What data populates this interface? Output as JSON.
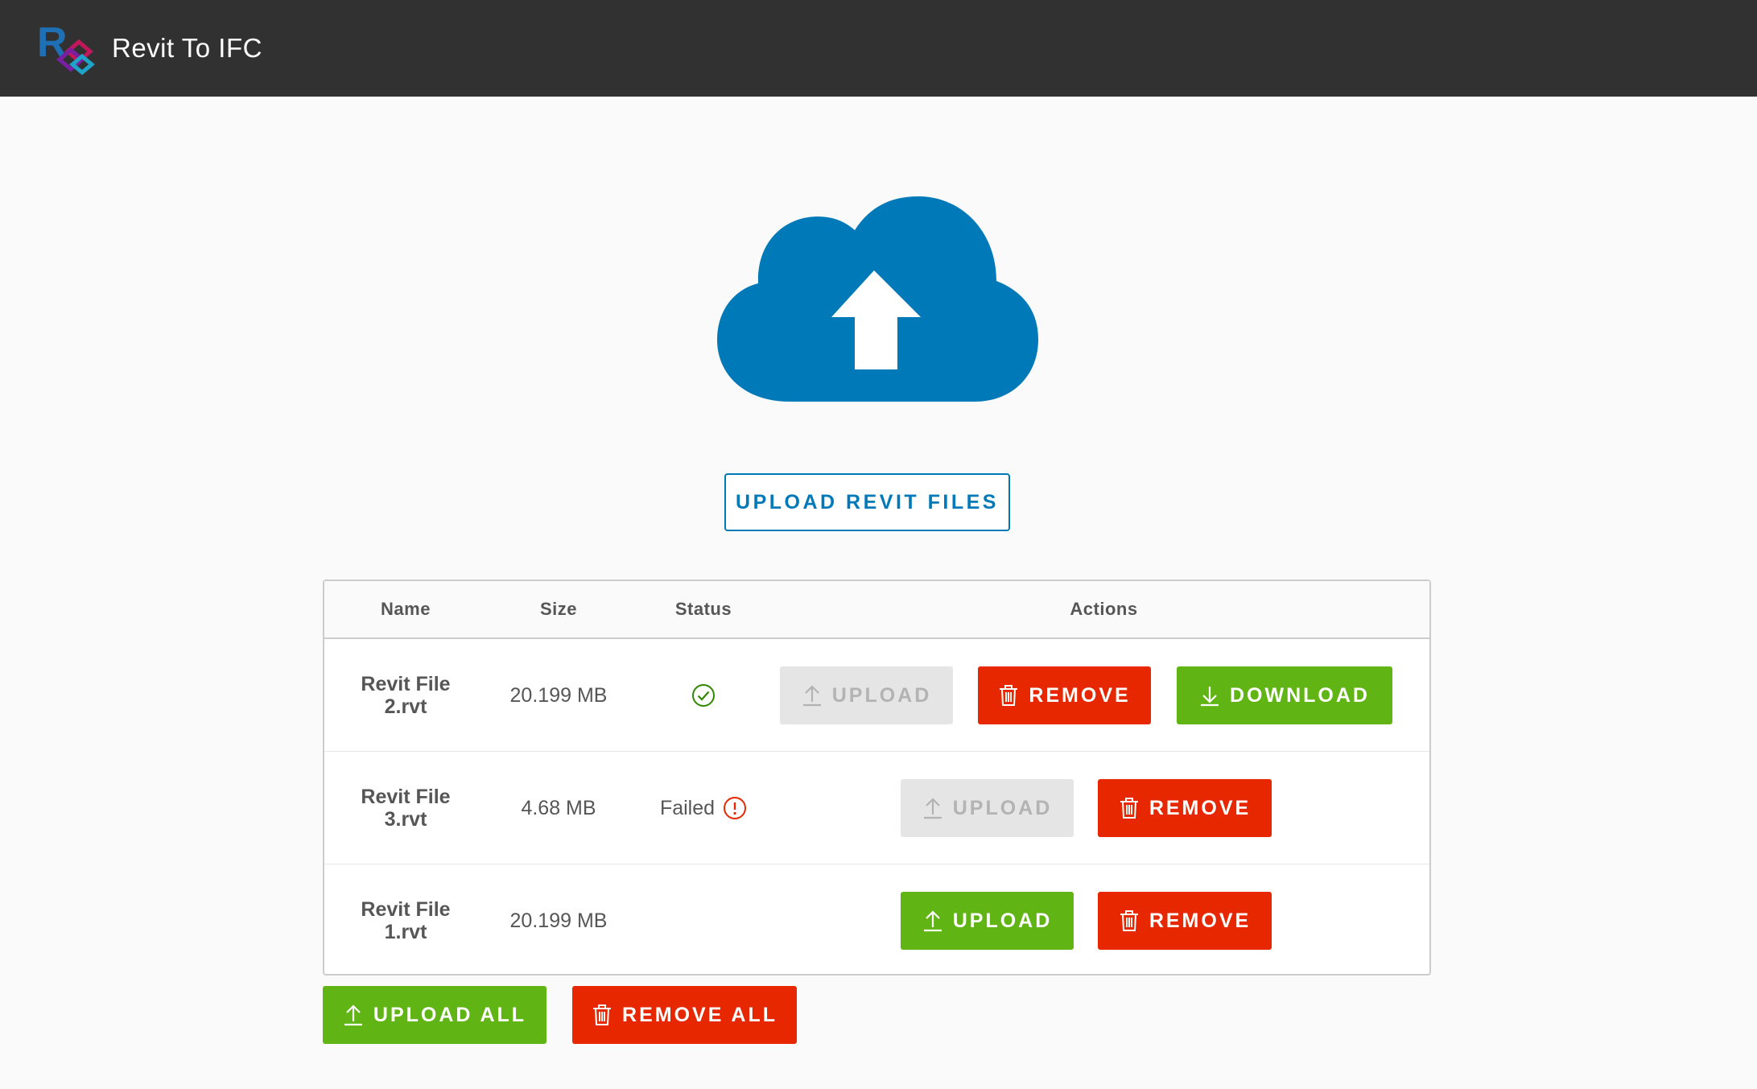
{
  "header": {
    "title": "Revit To IFC",
    "logo_letter": "R",
    "logo_icon": "revit-ifc-logo"
  },
  "hero": {
    "icon": "cloud-upload-icon",
    "color": "#0079b8",
    "upload_button": "UPLOAD REVIT FILES"
  },
  "table": {
    "columns": [
      "Name",
      "Size",
      "Status",
      "Actions"
    ],
    "rows": [
      {
        "name_line1": "Revit File",
        "name_line2": "2.rvt",
        "size": "20.199 MB",
        "status": "success",
        "status_text": "",
        "actions": {
          "upload": "UPLOAD",
          "remove": "REMOVE",
          "download": "DOWNLOAD"
        }
      },
      {
        "name_line1": "Revit File",
        "name_line2": "3.rvt",
        "size": "4.68 MB",
        "status": "failed",
        "status_text": "Failed",
        "actions": {
          "upload": "UPLOAD",
          "remove": "REMOVE"
        }
      },
      {
        "name_line1": "Revit File",
        "name_line2": "1.rvt",
        "size": "20.199 MB",
        "status": "pending",
        "status_text": "",
        "actions": {
          "upload": "UPLOAD",
          "remove": "REMOVE"
        }
      }
    ]
  },
  "footer": {
    "upload_all": "UPLOAD ALL",
    "remove_all": "REMOVE ALL"
  },
  "colors": {
    "header_bg": "#313131",
    "primary_blue": "#0079b8",
    "danger_red": "#e62700",
    "success_green": "#60b515",
    "disabled_gray": "#e5e5e5"
  }
}
